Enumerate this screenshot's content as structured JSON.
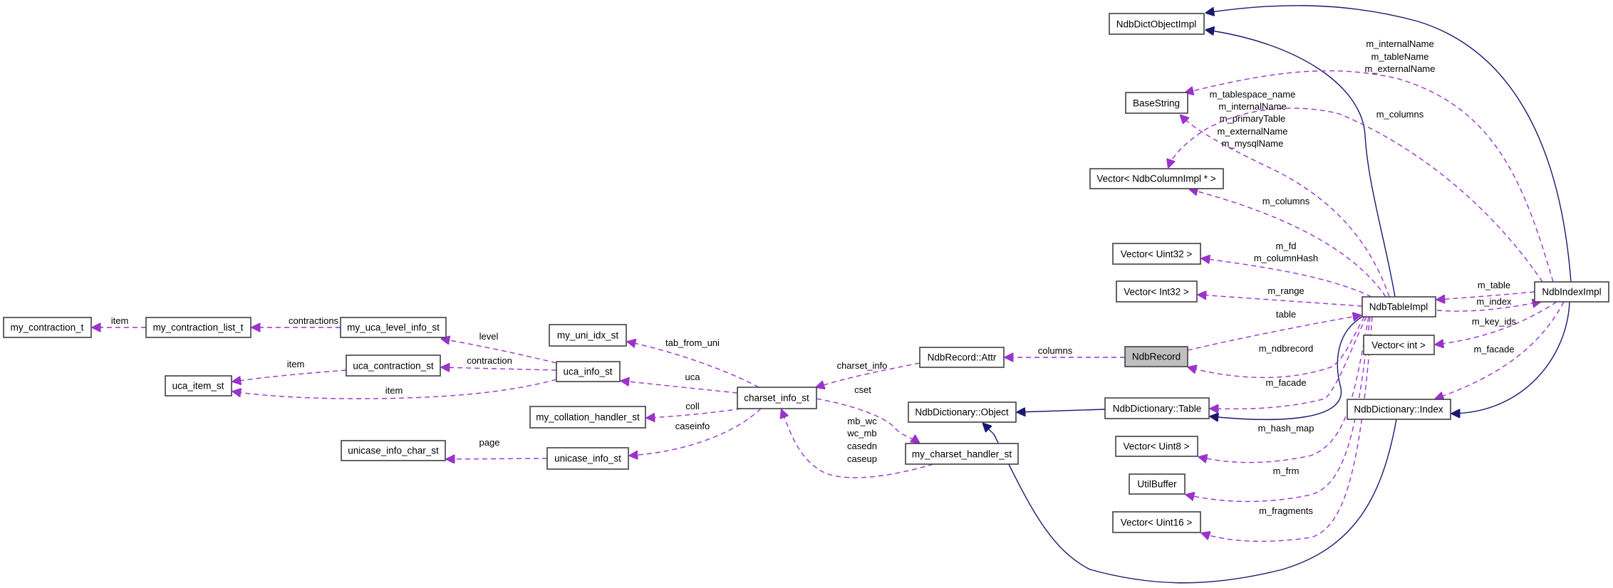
{
  "diagram": {
    "type": "collaboration-graph",
    "focus_node": "NdbRecord",
    "colors": {
      "dependency_edge": "#9a32cd",
      "inheritance_edge": "#191970",
      "focus_fill": "#bfbfbf",
      "node_border": "#404040"
    },
    "nodes": {
      "NdbDictObjectImpl": "NdbDictObjectImpl",
      "BaseString": "BaseString",
      "VectorNdbColumnImpl": "Vector< NdbColumnImpl * >",
      "VectorUint32": "Vector< Uint32 >",
      "VectorInt32": "Vector< Int32 >",
      "NdbTableImpl": "NdbTableImpl",
      "NdbIndexImpl": "NdbIndexImpl",
      "VectorInt": "Vector< int >",
      "NdbRecord": "NdbRecord",
      "NdbRecordAttr": "NdbRecord::Attr",
      "NdbDictionaryObject": "NdbDictionary::Object",
      "NdbDictionaryTable": "NdbDictionary::Table",
      "NdbDictionaryIndex": "NdbDictionary::Index",
      "VectorUint8": "Vector< Uint8 >",
      "UtilBuffer": "UtilBuffer",
      "VectorUint16": "Vector< Uint16 >",
      "charset_info_st": "charset_info_st",
      "my_charset_handler_st": "my_charset_handler_st",
      "my_uni_idx_st": "my_uni_idx_st",
      "uca_info_st": "uca_info_st",
      "my_collation_handler_st": "my_collation_handler_st",
      "unicase_info_st": "unicase_info_st",
      "unicase_info_char_st": "unicase_info_char_st",
      "my_uca_level_info_st": "my_uca_level_info_st",
      "uca_contraction_st": "uca_contraction_st",
      "uca_item_st": "uca_item_st",
      "my_contraction_list_t": "my_contraction_list_t",
      "my_contraction_t": "my_contraction_t"
    },
    "edge_labels": {
      "index_names": [
        "m_internalName",
        "m_tableName",
        "m_externalName"
      ],
      "table_names": [
        "m_tablespace_name",
        "m_internalName",
        "m_primaryTable",
        "m_externalName",
        "m_mysqlName"
      ],
      "index_columns": "m_columns",
      "table_columns": "m_columns",
      "fd_hash": [
        "m_fd",
        "m_columnHash"
      ],
      "range": "m_range",
      "table": "table",
      "m_table": "m_table",
      "m_index": "m_index",
      "m_key_ids": "m_key_ids",
      "m_facade_index": "m_facade",
      "m_ndbrecord": "m_ndbrecord",
      "m_facade_table": "m_facade",
      "m_hash_map": "m_hash_map",
      "m_frm": "m_frm",
      "m_fragments": "m_fragments",
      "columns": "columns",
      "charset_info": "charset_info",
      "cset": "cset",
      "handler_fns": [
        "mb_wc",
        "wc_mb",
        "casedn",
        "caseup"
      ],
      "tab_from_uni": "tab_from_uni",
      "uca": "uca",
      "coll": "coll",
      "caseinfo": "caseinfo",
      "page": "page",
      "level": "level",
      "contraction": "contraction",
      "item_uca": "item",
      "item_contraction": "item",
      "contractions": "contractions",
      "item_list": "item"
    }
  }
}
